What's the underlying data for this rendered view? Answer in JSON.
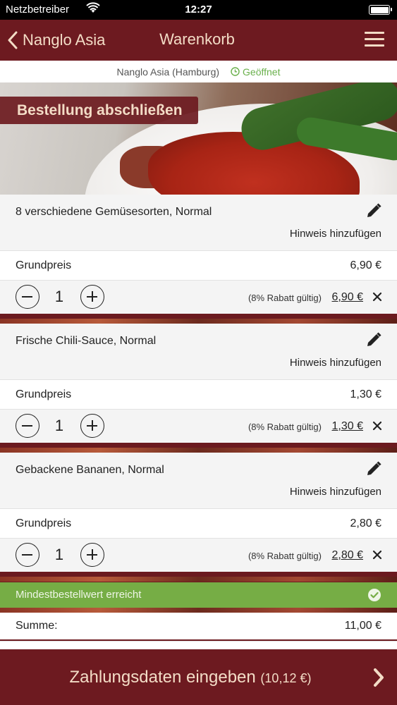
{
  "status_bar": {
    "carrier": "Netzbetreiber",
    "time": "12:27"
  },
  "nav": {
    "back_label": "Nanglo Asia",
    "title": "Warenkorb",
    "menu_icon": "hamburger-menu-icon",
    "text_color": "#f3dcc6",
    "bar_color": "#6d1a20"
  },
  "info": {
    "restaurant": "Nanglo Asia (Hamburg)",
    "status": "Geöffnet",
    "status_color": "#6ab04c"
  },
  "hero": {
    "banner": "Bestellung abschließen"
  },
  "items": [
    {
      "name": "8 verschiedene Gemüsesorten, Normal",
      "note": "Hinweis hinzufügen",
      "base_label": "Grundpreis",
      "base_price": "6,90 €",
      "qty": "1",
      "discount": "(8% Rabatt gültig)",
      "price": "6,90 €"
    },
    {
      "name": "Frische Chili-Sauce, Normal",
      "note": "Hinweis hinzufügen",
      "base_label": "Grundpreis",
      "base_price": "1,30 €",
      "qty": "1",
      "discount": "(8% Rabatt gültig)",
      "price": "1,30 €"
    },
    {
      "name": "Gebackene Bananen, Normal",
      "note": "Hinweis hinzufügen",
      "base_label": "Grundpreis",
      "base_price": "2,80 €",
      "qty": "1",
      "discount": "(8% Rabatt gültig)",
      "price": "2,80 €"
    }
  ],
  "min_order": {
    "text": "Mindestbestellwert erreicht",
    "color": "#76ad45"
  },
  "summary": {
    "label": "Summe:",
    "value": "11,00 €"
  },
  "footer": {
    "label": "Zahlungsdaten eingeben",
    "total": "(10,12 €)"
  }
}
